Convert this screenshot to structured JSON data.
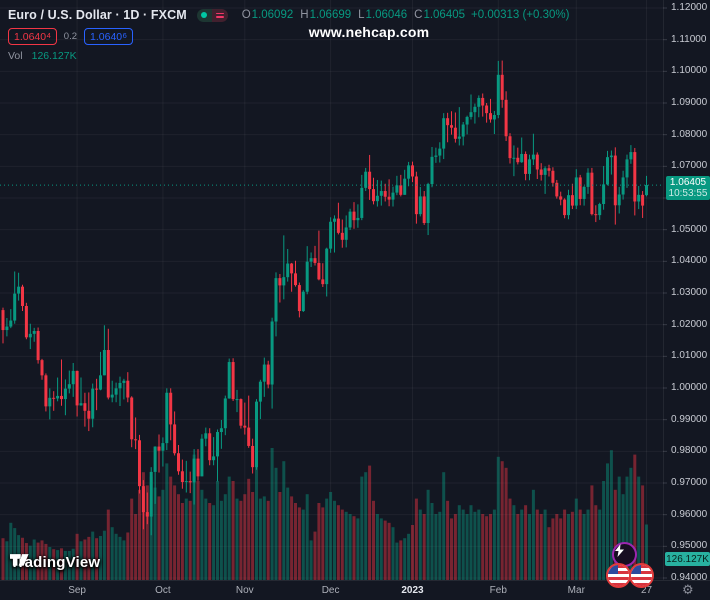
{
  "legend": {
    "title": "Euro / U.S. Dollar · 1D · FXCM",
    "ohlc": {
      "o_label": "O",
      "o_value": "1.06092",
      "h_label": "H",
      "h_value": "1.06699",
      "l_label": "L",
      "l_value": "1.06046",
      "c_label": "C",
      "c_value": "1.06405",
      "change": "+0.00313 (+0.30%)"
    },
    "bid": {
      "main": "1.0640",
      "sup": "4"
    },
    "spread": "0.2",
    "ask": {
      "main": "1.0640",
      "sup": "6"
    },
    "volume_row": {
      "label": "Vol",
      "value": "126.127K"
    }
  },
  "watermark": "www.nehcap.com",
  "logo": {
    "name": "TradingView"
  },
  "price_scale": {
    "current_price": "1.06405",
    "countdown": "10:53:55",
    "volume_badge": "126.127K"
  },
  "icons": {
    "source_toggle": "green-dot-and-pink-bars",
    "lightning": "lightning-bolt-icon",
    "flags": "us-flag-circle-icons",
    "gear": "settings-gear-icon",
    "gear_glyph": "⚙"
  },
  "colors": {
    "background": "#131722",
    "up": "#089981",
    "down": "#F23645",
    "accent_blue": "#2962FF",
    "badge_green": "#089981",
    "volume_badge_teal": "#28b1a0",
    "grid": "rgba(255,255,255,0.05)"
  },
  "chart_data": {
    "type": "candlestick",
    "symbol": "Euro / U.S. Dollar",
    "interval": "1D",
    "exchange": "FXCM",
    "ylabel": "",
    "xlabel": "",
    "ylim": [
      0.938,
      1.1225
    ],
    "price_step": 0.01,
    "grid": true,
    "current_price": 1.06405,
    "y_ticks": [
      "1.12000",
      "1.11000",
      "1.10000",
      "1.09000",
      "1.08000",
      "1.07000",
      "1.06000",
      "1.05000",
      "1.04000",
      "1.03000",
      "1.02000",
      "1.01000",
      "1.00000",
      "0.99000",
      "0.98000",
      "0.97000",
      "0.96000",
      "0.95000",
      "0.94000"
    ],
    "x_ticks": [
      {
        "label": "Sep",
        "index": 19
      },
      {
        "label": "Oct",
        "index": 41
      },
      {
        "label": "Nov",
        "index": 62
      },
      {
        "label": "Dec",
        "index": 84
      },
      {
        "label": "2023",
        "index": 105,
        "year": true
      },
      {
        "label": "Feb",
        "index": 127
      },
      {
        "label": "Mar",
        "index": 147
      },
      {
        "label": "27",
        "index": 165
      }
    ],
    "volume_max_k": 300,
    "candles": [
      [
        1.0246,
        1.0254,
        1.0141,
        1.0183
      ],
      [
        1.0183,
        1.0221,
        1.0163,
        1.0194
      ],
      [
        1.0194,
        1.0249,
        1.0189,
        1.0213
      ],
      [
        1.0213,
        1.0368,
        1.0203,
        1.0298
      ],
      [
        1.0298,
        1.0364,
        1.0276,
        1.032
      ],
      [
        1.032,
        1.0326,
        1.0243,
        1.0259
      ],
      [
        1.0259,
        1.0269,
        1.0154,
        1.016
      ],
      [
        1.016,
        1.0203,
        1.0123,
        1.0171
      ],
      [
        1.0171,
        1.019,
        1.0146,
        1.018
      ],
      [
        1.018,
        1.0191,
        1.0077,
        1.0088
      ],
      [
        1.0088,
        1.0092,
        1.0026,
        1.004
      ],
      [
        1.004,
        1.0046,
        0.9926,
        0.9942
      ],
      [
        0.9942,
        0.9999,
        0.9901,
        0.9969
      ],
      [
        0.9969,
        0.999,
        0.9928,
        0.9967
      ],
      [
        0.9967,
        1.0033,
        0.9958,
        0.9975
      ],
      [
        0.9975,
        1.009,
        0.9944,
        0.9965
      ],
      [
        0.9965,
        1.0027,
        0.9914,
        0.9998
      ],
      [
        0.9998,
        1.0055,
        0.9983,
        1.0012
      ],
      [
        1.0012,
        1.0079,
        0.9972,
        1.0054
      ],
      [
        1.0054,
        1.0055,
        0.991,
        0.9945
      ],
      [
        0.9945,
        1.0033,
        0.9944,
        0.9952
      ],
      [
        0.9952,
        0.9985,
        0.9878,
        0.9928
      ],
      [
        0.9928,
        0.9986,
        0.9864,
        0.9903
      ],
      [
        0.9903,
        1.0014,
        0.9876,
        0.9998
      ],
      [
        0.9998,
        1.0029,
        0.993,
        0.9995
      ],
      [
        0.9995,
        1.0114,
        0.9993,
        1.004
      ],
      [
        1.004,
        1.0198,
        1.004,
        1.012
      ],
      [
        1.012,
        1.0187,
        0.9964,
        0.997
      ],
      [
        0.997,
        1.0023,
        0.9955,
        0.9979
      ],
      [
        0.9979,
        1.0017,
        0.9955,
        0.9999
      ],
      [
        0.9999,
        1.0036,
        0.9943,
        1.0016
      ],
      [
        1.0016,
        1.0029,
        0.9964,
        1.0023
      ],
      [
        1.0023,
        1.005,
        0.9955,
        0.997
      ],
      [
        0.997,
        0.9974,
        0.9813,
        0.9838
      ],
      [
        0.9838,
        0.9907,
        0.9807,
        0.9835
      ],
      [
        0.9835,
        0.9852,
        0.9667,
        0.969
      ],
      [
        0.969,
        0.9709,
        0.9554,
        0.9608
      ],
      [
        0.9608,
        0.967,
        0.957,
        0.9594
      ],
      [
        0.9594,
        0.975,
        0.9535,
        0.9735
      ],
      [
        0.9735,
        0.9816,
        0.9634,
        0.9815
      ],
      [
        0.9815,
        0.9853,
        0.9733,
        0.9802
      ],
      [
        0.9802,
        0.9844,
        0.9752,
        0.9826
      ],
      [
        0.9826,
        0.9999,
        0.9804,
        0.9985
      ],
      [
        0.9985,
        0.9999,
        0.9835,
        0.9885
      ],
      [
        0.9885,
        0.9926,
        0.9787,
        0.9794
      ],
      [
        0.9794,
        0.982,
        0.9726,
        0.9737
      ],
      [
        0.9737,
        0.9774,
        0.9682,
        0.9703
      ],
      [
        0.9703,
        0.977,
        0.967,
        0.9706
      ],
      [
        0.9706,
        0.9736,
        0.9668,
        0.9702
      ],
      [
        0.9702,
        0.9807,
        0.9632,
        0.9777
      ],
      [
        0.9777,
        0.9807,
        0.9707,
        0.9721
      ],
      [
        0.9721,
        0.9854,
        0.9721,
        0.984
      ],
      [
        0.984,
        0.9875,
        0.9816,
        0.9857
      ],
      [
        0.9857,
        0.9873,
        0.9756,
        0.9772
      ],
      [
        0.9772,
        0.9845,
        0.9756,
        0.9784
      ],
      [
        0.9784,
        0.9869,
        0.9705,
        0.9861
      ],
      [
        0.9861,
        0.9899,
        0.9808,
        0.9873
      ],
      [
        0.9873,
        0.9976,
        0.9851,
        0.9967
      ],
      [
        0.9967,
        1.0093,
        0.9966,
        1.0082
      ],
      [
        1.0082,
        1.0094,
        0.9959,
        0.9965
      ],
      [
        0.9965,
        0.9994,
        0.9924,
        0.9965
      ],
      [
        0.9965,
        0.9967,
        0.9872,
        0.9881
      ],
      [
        0.9881,
        0.9954,
        0.9853,
        0.9875
      ],
      [
        0.9875,
        0.9976,
        0.9811,
        0.9817
      ],
      [
        0.9817,
        0.984,
        0.973,
        0.975
      ],
      [
        0.975,
        0.9965,
        0.9742,
        0.9957
      ],
      [
        0.9957,
        1.0026,
        0.9902,
        1.002
      ],
      [
        1.002,
        1.0096,
        0.9972,
        1.0074
      ],
      [
        1.0074,
        1.0086,
        0.9999,
        1.0011
      ],
      [
        1.0011,
        1.0222,
        0.9935,
        1.021
      ],
      [
        1.021,
        1.0365,
        1.0163,
        1.0347
      ],
      [
        1.0347,
        1.036,
        1.027,
        1.0324
      ],
      [
        1.0324,
        1.0482,
        1.028,
        1.035
      ],
      [
        1.035,
        1.0439,
        1.0336,
        1.0393
      ],
      [
        1.0393,
        1.0395,
        1.0304,
        1.0362
      ],
      [
        1.0362,
        1.0402,
        1.032,
        1.0325
      ],
      [
        1.0325,
        1.0333,
        1.0223,
        1.0243
      ],
      [
        1.0243,
        1.0309,
        1.024,
        1.0304
      ],
      [
        1.0304,
        1.0448,
        1.0296,
        1.0399
      ],
      [
        1.0399,
        1.0428,
        1.0382,
        1.041
      ],
      [
        1.041,
        1.0449,
        1.0387,
        1.0395
      ],
      [
        1.0395,
        1.0497,
        1.034,
        1.0343
      ],
      [
        1.0343,
        1.0394,
        1.0319,
        1.0328
      ],
      [
        1.0328,
        1.0443,
        1.0289,
        1.044
      ],
      [
        1.044,
        1.0539,
        1.0427,
        1.0525
      ],
      [
        1.0525,
        1.0545,
        1.0428,
        1.0535
      ],
      [
        1.0535,
        1.0585,
        1.0485,
        1.049
      ],
      [
        1.049,
        1.0532,
        1.0443,
        1.0468
      ],
      [
        1.0468,
        1.0545,
        1.0444,
        1.0507
      ],
      [
        1.0507,
        1.0566,
        1.0499,
        1.0557
      ],
      [
        1.0557,
        1.0587,
        1.0503,
        1.053
      ],
      [
        1.053,
        1.058,
        1.0506,
        1.0537
      ],
      [
        1.0537,
        1.0673,
        1.053,
        1.0632
      ],
      [
        1.0632,
        1.0695,
        1.0622,
        1.0683
      ],
      [
        1.0683,
        1.0736,
        1.0594,
        1.0628
      ],
      [
        1.0628,
        1.0664,
        1.058,
        1.059
      ],
      [
        1.059,
        1.0657,
        1.0573,
        1.0607
      ],
      [
        1.0607,
        1.0655,
        1.0576,
        1.0622
      ],
      [
        1.0622,
        1.0645,
        1.0589,
        1.0604
      ],
      [
        1.0604,
        1.0659,
        1.0574,
        1.0595
      ],
      [
        1.0595,
        1.0636,
        1.0573,
        1.0617
      ],
      [
        1.0617,
        1.067,
        1.0609,
        1.064
      ],
      [
        1.064,
        1.0673,
        1.0605,
        1.061
      ],
      [
        1.061,
        1.0689,
        1.061,
        1.0661
      ],
      [
        1.0661,
        1.0714,
        1.0637,
        1.0703
      ],
      [
        1.0703,
        1.0715,
        1.065,
        1.0668
      ],
      [
        1.0668,
        1.0683,
        1.0519,
        1.0549
      ],
      [
        1.0549,
        1.0635,
        1.0542,
        1.0605
      ],
      [
        1.0605,
        1.0622,
        1.0515,
        1.0521
      ],
      [
        1.0521,
        1.0648,
        1.0483,
        1.0644
      ],
      [
        1.0644,
        1.0761,
        1.0634,
        1.073
      ],
      [
        1.073,
        1.0759,
        1.0711,
        1.0734
      ],
      [
        1.0734,
        1.0776,
        1.0712,
        1.0756
      ],
      [
        1.0756,
        1.0868,
        1.0723,
        1.0852
      ],
      [
        1.0852,
        1.0869,
        1.0776,
        1.083
      ],
      [
        1.083,
        1.0874,
        1.08,
        1.0822
      ],
      [
        1.0822,
        1.087,
        1.0775,
        1.0787
      ],
      [
        1.0787,
        1.0887,
        1.0766,
        1.0794
      ],
      [
        1.0794,
        1.084,
        1.0766,
        1.0832
      ],
      [
        1.0832,
        1.086,
        1.0801,
        1.0856
      ],
      [
        1.0856,
        1.0927,
        1.0848,
        1.0871
      ],
      [
        1.0871,
        1.0898,
        1.0835,
        1.0888
      ],
      [
        1.0888,
        1.0924,
        1.0855,
        1.0916
      ],
      [
        1.0916,
        1.093,
        1.0857,
        1.0892
      ],
      [
        1.0892,
        1.09,
        1.0838,
        1.0868
      ],
      [
        1.0868,
        1.0913,
        1.0838,
        1.0848
      ],
      [
        1.0848,
        1.0875,
        1.0802,
        1.0862
      ],
      [
        1.0862,
        1.1033,
        1.0852,
        1.0989
      ],
      [
        1.0989,
        1.1034,
        1.0885,
        1.091
      ],
      [
        1.091,
        1.0937,
        1.078,
        1.0795
      ],
      [
        1.0795,
        1.0805,
        1.0709,
        1.0726
      ],
      [
        1.0726,
        1.0766,
        1.0669,
        1.0727
      ],
      [
        1.0727,
        1.0759,
        1.0706,
        1.0713
      ],
      [
        1.0713,
        1.0791,
        1.0711,
        1.0739
      ],
      [
        1.0739,
        1.0747,
        1.0656,
        1.0676
      ],
      [
        1.0676,
        1.0737,
        1.0656,
        1.0722
      ],
      [
        1.0722,
        1.0803,
        1.0704,
        1.0737
      ],
      [
        1.0737,
        1.0744,
        1.066,
        1.069
      ],
      [
        1.069,
        1.071,
        1.0655,
        1.0673
      ],
      [
        1.0673,
        1.07,
        1.0613,
        1.0694
      ],
      [
        1.0694,
        1.0705,
        1.0668,
        1.0686
      ],
      [
        1.0686,
        1.0697,
        1.0636,
        1.0648
      ],
      [
        1.0648,
        1.0657,
        1.0598,
        1.0605
      ],
      [
        1.0605,
        1.062,
        1.0577,
        1.0595
      ],
      [
        1.0595,
        1.0599,
        1.0536,
        1.0546
      ],
      [
        1.0546,
        1.0626,
        1.0533,
        1.0609
      ],
      [
        1.0609,
        1.0645,
        1.0565,
        1.0576
      ],
      [
        1.0576,
        1.0691,
        1.0565,
        1.0665
      ],
      [
        1.0665,
        1.0673,
        1.0577,
        1.0597
      ],
      [
        1.0597,
        1.0638,
        1.0576,
        1.0635
      ],
      [
        1.0635,
        1.0694,
        1.0613,
        1.068
      ],
      [
        1.068,
        1.0695,
        1.0545,
        1.0549
      ],
      [
        1.0549,
        1.0577,
        1.0524,
        1.0546
      ],
      [
        1.0546,
        1.0585,
        1.0531,
        1.0581
      ],
      [
        1.0581,
        1.0701,
        1.0563,
        1.0643
      ],
      [
        1.0643,
        1.0749,
        1.064,
        1.0729
      ],
      [
        1.0729,
        1.075,
        1.0674,
        1.0734
      ],
      [
        1.0734,
        1.076,
        1.0516,
        1.0577
      ],
      [
        1.0577,
        1.0635,
        1.0551,
        1.0611
      ],
      [
        1.0611,
        1.0686,
        1.0595,
        1.0665
      ],
      [
        1.0665,
        1.0737,
        1.0632,
        1.0722
      ],
      [
        1.0722,
        1.0767,
        1.0708,
        1.0745
      ],
      [
        1.0745,
        1.0758,
        1.0545,
        1.0589
      ],
      [
        1.0589,
        1.0638,
        1.0565,
        1.061
      ],
      [
        1.061,
        1.0622,
        1.0537,
        1.0576
      ],
      [
        1.0609,
        1.067,
        1.0605,
        1.0641
      ]
    ],
    "volume_k": [
      95,
      88,
      130,
      118,
      102,
      96,
      84,
      78,
      92,
      85,
      90,
      82,
      75,
      70,
      68,
      72,
      66,
      66,
      71,
      105,
      88,
      92,
      98,
      110,
      95,
      100,
      112,
      160,
      120,
      105,
      98,
      90,
      108,
      185,
      150,
      205,
      245,
      215,
      235,
      210,
      190,
      205,
      265,
      235,
      215,
      195,
      175,
      185,
      180,
      285,
      225,
      205,
      185,
      175,
      170,
      225,
      180,
      195,
      235,
      225,
      185,
      180,
      195,
      230,
      200,
      260,
      185,
      190,
      180,
      300,
      255,
      200,
      270,
      210,
      190,
      175,
      165,
      160,
      195,
      90,
      110,
      175,
      165,
      185,
      200,
      180,
      170,
      160,
      155,
      150,
      145,
      140,
      235,
      245,
      260,
      180,
      150,
      140,
      135,
      130,
      120,
      85,
      90,
      95,
      105,
      125,
      185,
      160,
      150,
      205,
      175,
      150,
      155,
      245,
      180,
      140,
      150,
      170,
      160,
      150,
      170,
      155,
      160,
      150,
      145,
      150,
      160,
      280,
      270,
      255,
      185,
      170,
      150,
      160,
      170,
      150,
      205,
      160,
      150,
      160,
      120,
      140,
      150,
      140,
      160,
      150,
      155,
      185,
      160,
      150,
      160,
      215,
      170,
      160,
      225,
      265,
      295,
      205,
      235,
      195,
      235,
      255,
      285,
      235,
      215,
      126.127
    ]
  }
}
